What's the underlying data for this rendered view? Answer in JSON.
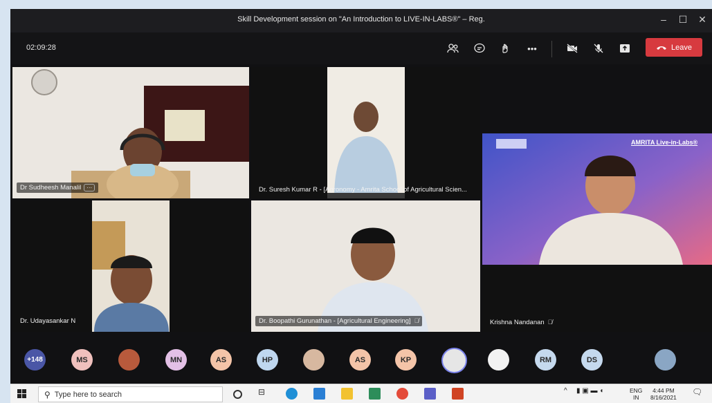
{
  "window": {
    "title": "Skill Development session on \"An Introduction to LIVE-IN-LABS®\" – Reg.",
    "minimize": "–",
    "maximize": "☐",
    "close": "✕"
  },
  "toolbar": {
    "timer": "02:09:28",
    "leave_label": "Leave"
  },
  "participants": {
    "tile1_name": "Dr Sudheesh Manalil",
    "tile2_name": "Dr. Suresh Kumar R - [Agronomy - Amrita School of Agricultural Scien...",
    "tile3_slide_text": "AMRITA Live-in-Labs®",
    "tile4_name": "Dr. Udayasankar N",
    "tile5_name": "Dr. Boopathi Gurunathan - [Agricultural Engineering]",
    "tile6_name": "Krishna Nandanan"
  },
  "avatars": [
    {
      "label": "+148",
      "color": "#4a56a6"
    },
    {
      "label": "MS",
      "color": "#f0c0bd"
    },
    {
      "label": "",
      "color": "#b85a3c"
    },
    {
      "label": "MN",
      "color": "#e3c0e6"
    },
    {
      "label": "AS",
      "color": "#f4c4a8"
    },
    {
      "label": "HP",
      "color": "#bfd7ef"
    },
    {
      "label": "",
      "color": "#d7b8a0"
    },
    {
      "label": "AS",
      "color": "#f4c4a8"
    },
    {
      "label": "KP",
      "color": "#f4c4a8"
    },
    {
      "label": "",
      "color": "#e6e6e6"
    },
    {
      "label": "",
      "color": "#f2f2f2"
    },
    {
      "label": "RM",
      "color": "#c5d9ee"
    },
    {
      "label": "DS",
      "color": "#c5d9ee"
    },
    {
      "label": "",
      "color": "#8aa6c4"
    }
  ],
  "taskbar": {
    "search_placeholder": "Type here to search",
    "lang": "ENG",
    "region": "IN",
    "time": "4:44 PM",
    "date": "8/16/2021"
  }
}
